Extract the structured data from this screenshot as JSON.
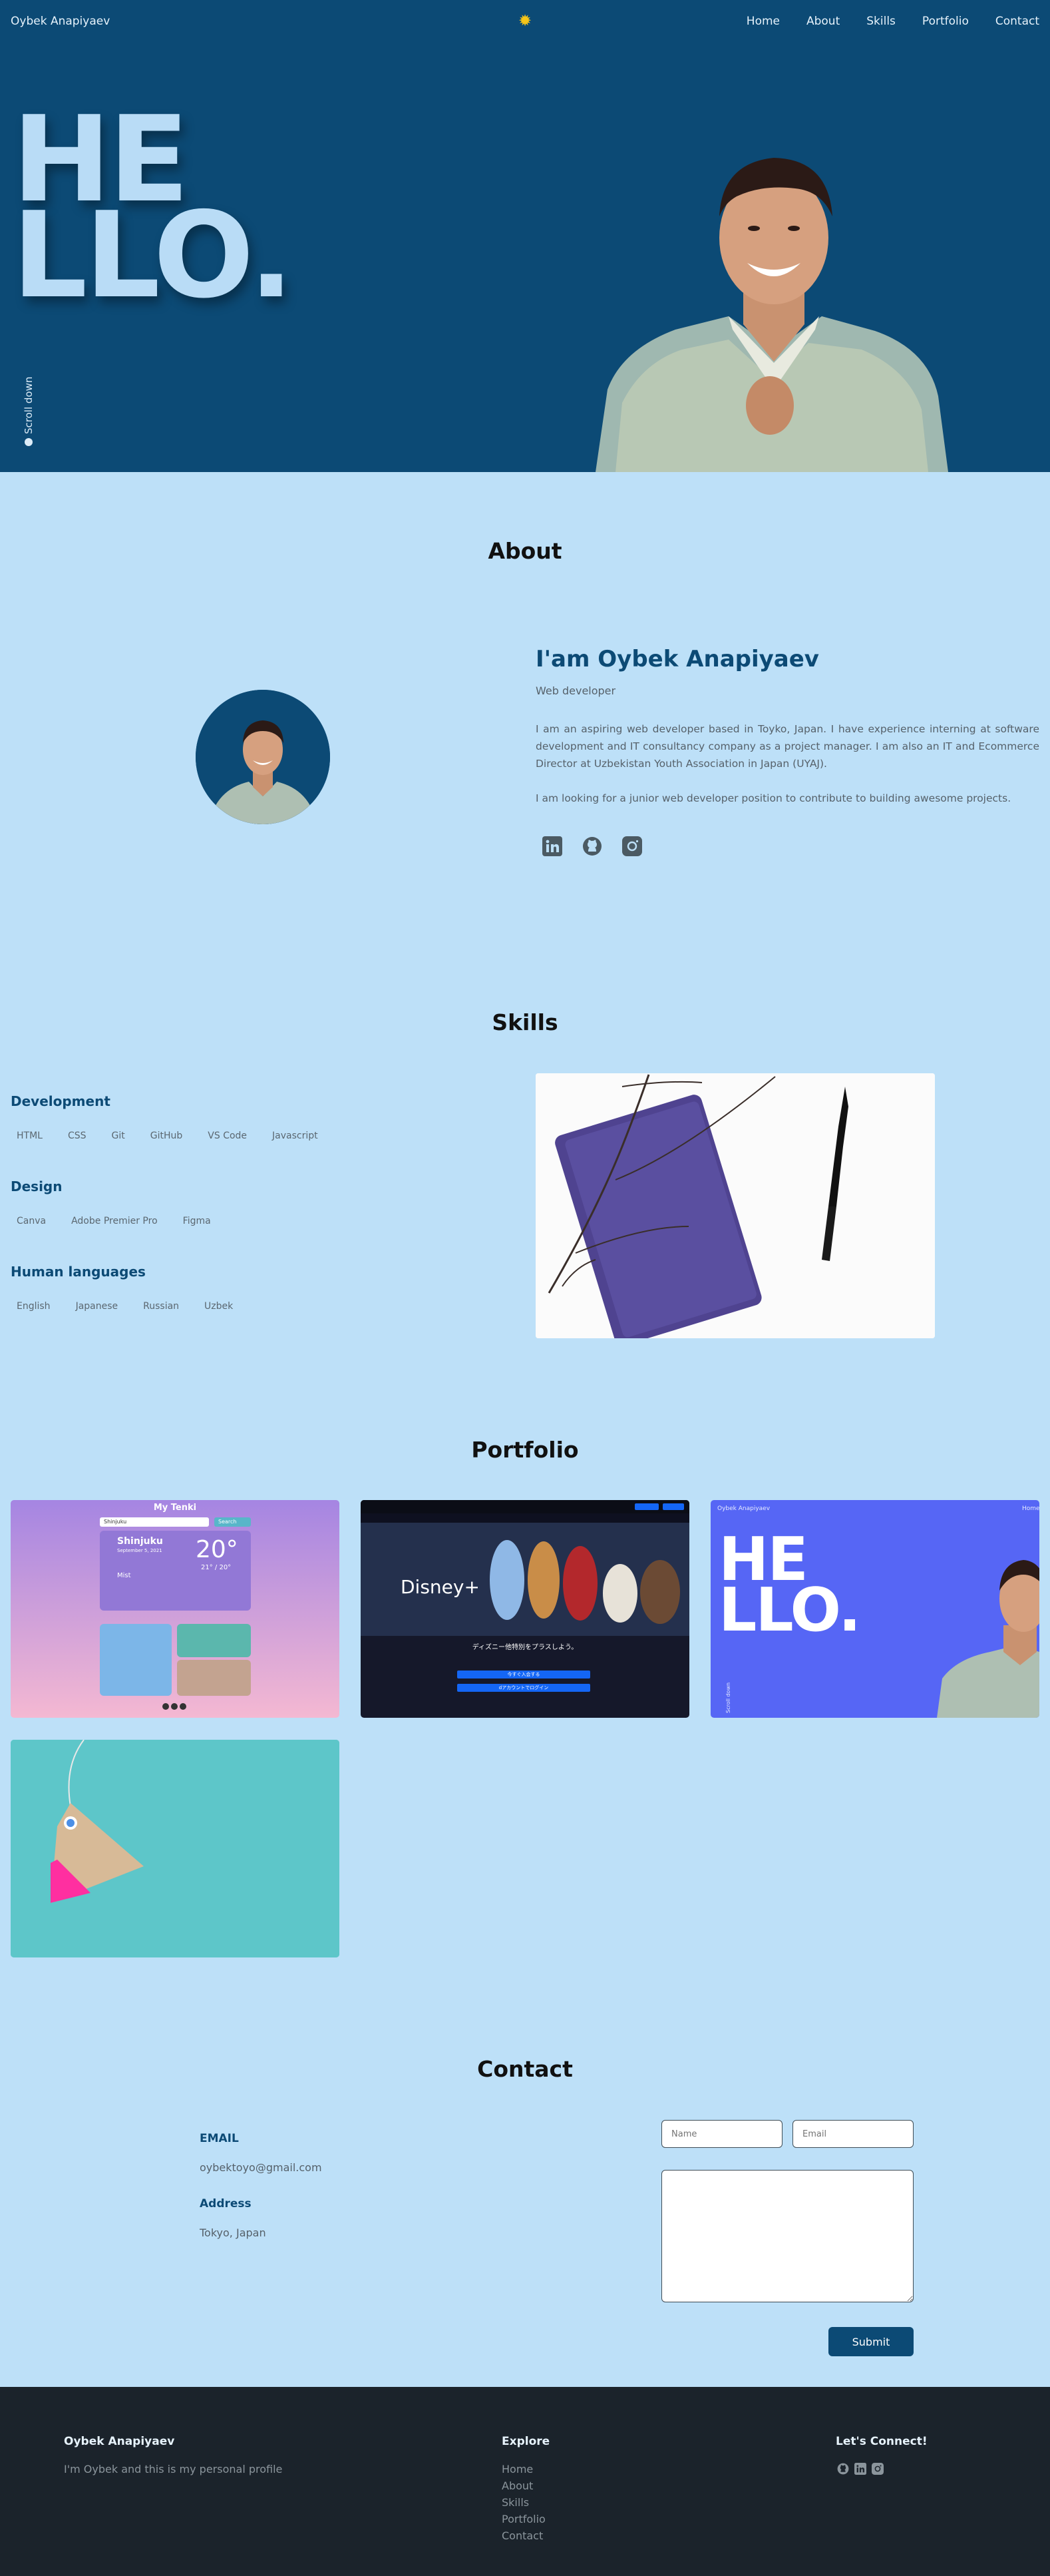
{
  "nav": {
    "brand": "Oybek Anapiyaev",
    "theme_icon": "sun-icon",
    "links": [
      "Home",
      "About",
      "Skills",
      "Portfolio",
      "Contact"
    ]
  },
  "hero": {
    "hello_line1": "HE",
    "hello_line2": "LLO.",
    "scroll_down": "Scroll down"
  },
  "about": {
    "title": "About",
    "name": "I'am Oybek Anapiyaev",
    "role": "Web developer",
    "paragraph1": "I am an aspiring web developer based in Toyko, Japan. I have experience interning at software development and IT consultancy company as a project manager. I am also an IT and Ecommerce Director at Uzbekistan Youth Association in Japan (UYAJ).",
    "paragraph2": "I am looking for a junior web developer position to contribute to building awesome projects.",
    "social_icons": [
      "linkedin-icon",
      "github-icon",
      "instagram-icon"
    ]
  },
  "skills": {
    "title": "Skills",
    "groups": [
      {
        "title": "Development",
        "items": [
          "HTML",
          "CSS",
          "Git",
          "GitHub",
          "VS Code",
          "Javascript"
        ]
      },
      {
        "title": "Design",
        "items": [
          "Canva",
          "Adobe Premier Pro",
          "Figma"
        ]
      },
      {
        "title": "Human languages",
        "items": [
          "English",
          "Japanese",
          "Russian",
          "Uzbek"
        ]
      }
    ]
  },
  "portfolio": {
    "title": "Portfolio",
    "weather": {
      "app_title": "My Tenki",
      "search_value": "Shinjuku",
      "search_button": "Search",
      "city": "Shinjuku",
      "date": "September 5, 2021",
      "temp": "20°",
      "range": "21° / 20°",
      "condition": "Mist"
    },
    "disney": {
      "headline": "ディズニー他特別をプラスしよう。",
      "btn1": "今すぐ入会する",
      "btn2": "dアカウントでログイン"
    },
    "hello_mini": {
      "brand": "Oybek Anapiyaev",
      "nav": "Home",
      "line1": "HE",
      "line2": "LLO.",
      "scroll": "Scroll down"
    }
  },
  "contact": {
    "title": "Contact",
    "email_label": "EMAIL",
    "email_value": "oybektoyo@gmail.com",
    "address_label": "Address",
    "address_value": "Tokyo, Japan",
    "name_placeholder": "Name",
    "email_placeholder": "Email",
    "submit": "Submit"
  },
  "footer": {
    "brand": "Oybek Anapiyaev",
    "tagline": "I'm Oybek and this is my personal profile",
    "explore_title": "Explore",
    "explore_links": [
      "Home",
      "About",
      "Skills",
      "Portfolio",
      "Contact"
    ],
    "connect_title": "Let's Connect!",
    "connect_icons": [
      "github-icon",
      "linkedin-icon",
      "instagram-icon"
    ]
  }
}
